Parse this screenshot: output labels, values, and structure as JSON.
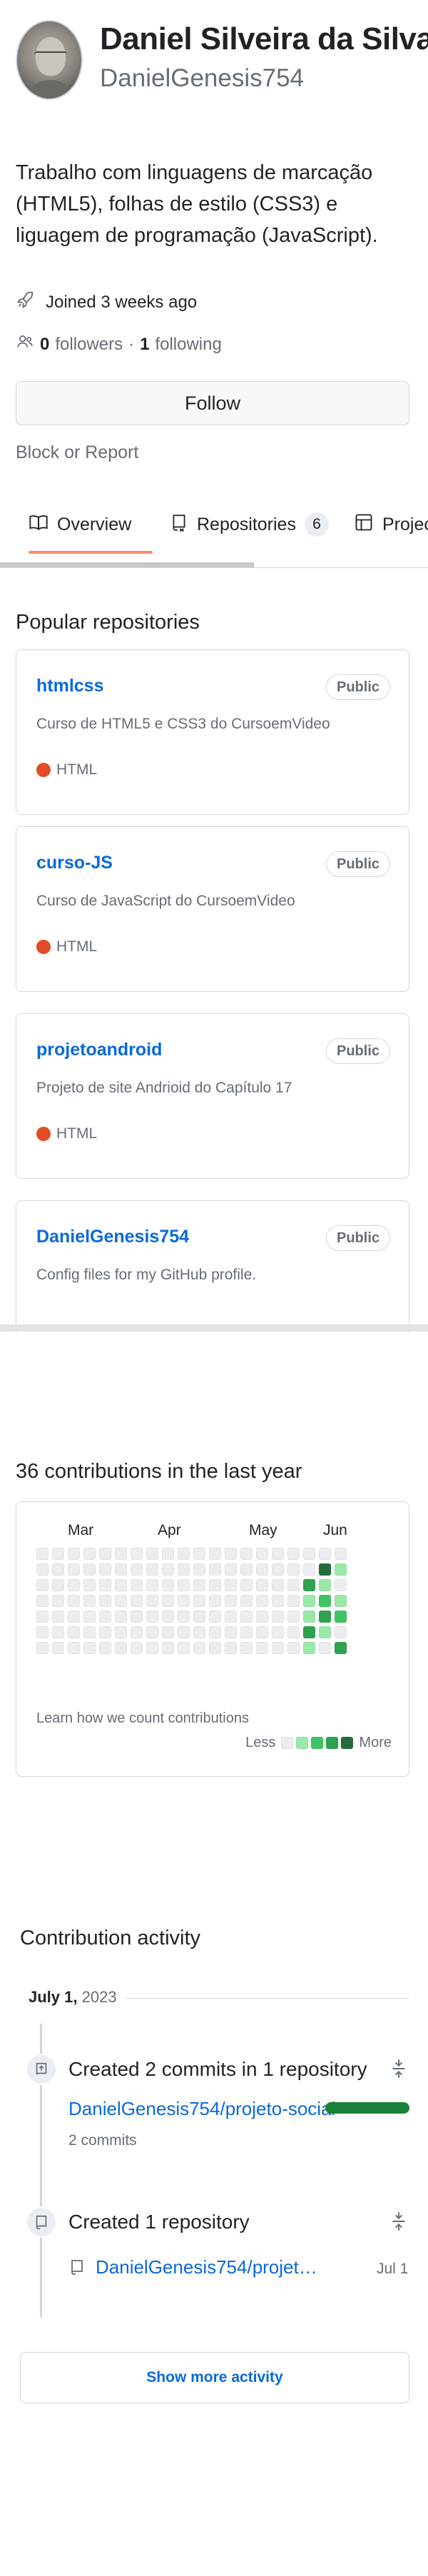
{
  "profile": {
    "name": "Daniel Silveira da Silva",
    "login": "DanielGenesis754",
    "bio": "Trabalho com linguagens de marcação (HTML5), folhas de estilo (CSS3) e liguagem de programação (JavaScript).",
    "joined": "Joined 3 weeks ago",
    "followers_count": "0",
    "followers_label": "followers",
    "separator": "·",
    "following_count": "1",
    "following_label": "following",
    "follow_button": "Follow",
    "block_report": "Block or Report"
  },
  "tabs": [
    {
      "label": "Overview"
    },
    {
      "label": "Repositories",
      "count": "6"
    },
    {
      "label": "Projects"
    }
  ],
  "popular": {
    "title": "Popular repositories",
    "repos": [
      {
        "name": "htmlcss",
        "visibility": "Public",
        "description": "Curso de HTML5 e CSS3 do CursoemVideo",
        "language": "HTML",
        "language_color": "#e34c26"
      },
      {
        "name": "curso-JS",
        "visibility": "Public",
        "description": "Curso de JavaScript do CursoemVideo",
        "language": "HTML",
        "language_color": "#e34c26"
      },
      {
        "name": "projetoandroid",
        "visibility": "Public",
        "description": "Projeto de site Andrioid do Capítulo 17",
        "language": "HTML",
        "language_color": "#e34c26"
      },
      {
        "name": "DanielGenesis754",
        "visibility": "Public",
        "description": "Config files for my GitHub profile."
      }
    ]
  },
  "contributions": {
    "title": "36 contributions in the last year",
    "months": [
      "Mar",
      "Apr",
      "May",
      "Jun"
    ],
    "learn": "Learn how we count contributions",
    "legend_less": "Less",
    "legend_more": "More",
    "colors": [
      "#ebedf0",
      "#9be9a8",
      "#40c463",
      "#30a14e",
      "#216e39"
    ]
  },
  "activity": {
    "title": "Contribution activity",
    "month_bold": "July 1,",
    "month_year": "2023",
    "items": [
      {
        "heading": "Created 2 commits in 1 repository",
        "repo": "DanielGenesis754/projeto-social",
        "detail": "2 commits",
        "share": 1.0
      },
      {
        "heading": "Created 1 repository",
        "repo": "DanielGenesis754/projet…",
        "date": "Jul 1"
      }
    ],
    "show_more": "Show more activity"
  }
}
